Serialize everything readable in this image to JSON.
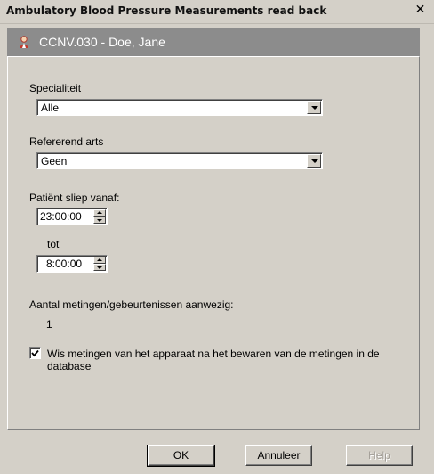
{
  "window": {
    "title": "Ambulatory Blood Pressure Measurements read back",
    "close_glyph": "✕"
  },
  "patient": {
    "label": "CCNV.030 - Doe, Jane",
    "icon": "patient-icon"
  },
  "form": {
    "specialiteit_label": "Specialiteit",
    "specialiteit_value": "Alle",
    "refererend_label": "Refererend arts",
    "refererend_value": "Geen",
    "sleep_from_label": "Patiënt sliep vanaf:",
    "sleep_from_value": "23:00:00",
    "sleep_to_label": "tot",
    "sleep_to_value": "8:00:00",
    "count_label": "Aantal metingen/gebeurtenissen aanwezig:",
    "count_value": "1",
    "wipe_checked": true,
    "wipe_label_line1": "Wis metingen van het apparaat na het bewaren van de metingen in de",
    "wipe_label_line2": "database"
  },
  "buttons": {
    "ok": "OK",
    "cancel": "Annuleer",
    "help": "Help"
  }
}
